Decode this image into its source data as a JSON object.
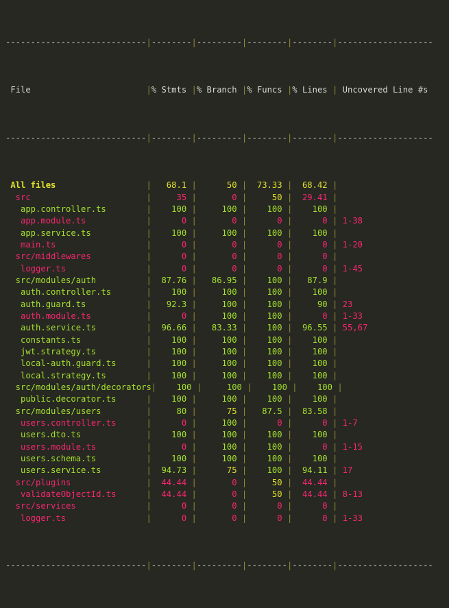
{
  "terminal": {
    "background": "#272822",
    "colors": {
      "text": "#d8d8d2",
      "separator_pipe": "#8f8b36",
      "green": "#a6e22e",
      "yellow": "#e3e32a",
      "pink": "#f92672"
    }
  },
  "report": {
    "type": "coverage-summary-table",
    "columns": [
      {
        "key": "file",
        "label": "File",
        "width": 28,
        "align": "left"
      },
      {
        "key": "stmts",
        "label": "% Stmts",
        "width": 8,
        "align": "right"
      },
      {
        "key": "branch",
        "label": "% Branch",
        "width": 9,
        "align": "right"
      },
      {
        "key": "funcs",
        "label": "% Funcs",
        "width": 8,
        "align": "right"
      },
      {
        "key": "lines",
        "label": "% Lines",
        "width": 8,
        "align": "right"
      },
      {
        "key": "uncovered",
        "label": "Uncovered Line #s",
        "width": 19,
        "align": "left"
      }
    ],
    "separator_char": "-",
    "pipe_char": "|",
    "rows": [
      {
        "indent": 0,
        "file": "All files",
        "bold": true,
        "file_color": "yellow",
        "stmts": "68.1",
        "stmts_color": "yellow",
        "branch": "50",
        "branch_color": "yellow",
        "funcs": "73.33",
        "funcs_color": "yellow",
        "lines": "68.42",
        "lines_color": "yellow",
        "uncovered": "",
        "uncovered_color": "pink"
      },
      {
        "indent": 1,
        "file": "src",
        "bold": false,
        "file_color": "pink",
        "stmts": "35",
        "stmts_color": "pink",
        "branch": "0",
        "branch_color": "pink",
        "funcs": "50",
        "funcs_color": "yellow",
        "lines": "29.41",
        "lines_color": "pink",
        "uncovered": "",
        "uncovered_color": "pink"
      },
      {
        "indent": 2,
        "file": "app.controller.ts",
        "bold": false,
        "file_color": "green",
        "stmts": "100",
        "stmts_color": "green",
        "branch": "100",
        "branch_color": "green",
        "funcs": "100",
        "funcs_color": "green",
        "lines": "100",
        "lines_color": "green",
        "uncovered": "",
        "uncovered_color": "pink"
      },
      {
        "indent": 2,
        "file": "app.module.ts",
        "bold": false,
        "file_color": "pink",
        "stmts": "0",
        "stmts_color": "pink",
        "branch": "0",
        "branch_color": "pink",
        "funcs": "0",
        "funcs_color": "pink",
        "lines": "0",
        "lines_color": "pink",
        "uncovered": "1-38",
        "uncovered_color": "pink"
      },
      {
        "indent": 2,
        "file": "app.service.ts",
        "bold": false,
        "file_color": "green",
        "stmts": "100",
        "stmts_color": "green",
        "branch": "100",
        "branch_color": "green",
        "funcs": "100",
        "funcs_color": "green",
        "lines": "100",
        "lines_color": "green",
        "uncovered": "",
        "uncovered_color": "pink"
      },
      {
        "indent": 2,
        "file": "main.ts",
        "bold": false,
        "file_color": "pink",
        "stmts": "0",
        "stmts_color": "pink",
        "branch": "0",
        "branch_color": "pink",
        "funcs": "0",
        "funcs_color": "pink",
        "lines": "0",
        "lines_color": "pink",
        "uncovered": "1-20",
        "uncovered_color": "pink"
      },
      {
        "indent": 1,
        "file": "src/middlewares",
        "bold": false,
        "file_color": "pink",
        "stmts": "0",
        "stmts_color": "pink",
        "branch": "0",
        "branch_color": "pink",
        "funcs": "0",
        "funcs_color": "pink",
        "lines": "0",
        "lines_color": "pink",
        "uncovered": "",
        "uncovered_color": "pink"
      },
      {
        "indent": 2,
        "file": "logger.ts",
        "bold": false,
        "file_color": "pink",
        "stmts": "0",
        "stmts_color": "pink",
        "branch": "0",
        "branch_color": "pink",
        "funcs": "0",
        "funcs_color": "pink",
        "lines": "0",
        "lines_color": "pink",
        "uncovered": "1-45",
        "uncovered_color": "pink"
      },
      {
        "indent": 1,
        "file": "src/modules/auth",
        "bold": false,
        "file_color": "green",
        "stmts": "87.76",
        "stmts_color": "green",
        "branch": "86.95",
        "branch_color": "green",
        "funcs": "100",
        "funcs_color": "green",
        "lines": "87.9",
        "lines_color": "green",
        "uncovered": "",
        "uncovered_color": "pink"
      },
      {
        "indent": 2,
        "file": "auth.controller.ts",
        "bold": false,
        "file_color": "green",
        "stmts": "100",
        "stmts_color": "green",
        "branch": "100",
        "branch_color": "green",
        "funcs": "100",
        "funcs_color": "green",
        "lines": "100",
        "lines_color": "green",
        "uncovered": "",
        "uncovered_color": "pink"
      },
      {
        "indent": 2,
        "file": "auth.guard.ts",
        "bold": false,
        "file_color": "green",
        "stmts": "92.3",
        "stmts_color": "green",
        "branch": "100",
        "branch_color": "green",
        "funcs": "100",
        "funcs_color": "green",
        "lines": "90",
        "lines_color": "green",
        "uncovered": "23",
        "uncovered_color": "pink"
      },
      {
        "indent": 2,
        "file": "auth.module.ts",
        "bold": false,
        "file_color": "pink",
        "stmts": "0",
        "stmts_color": "pink",
        "branch": "100",
        "branch_color": "green",
        "funcs": "100",
        "funcs_color": "green",
        "lines": "0",
        "lines_color": "pink",
        "uncovered": "1-33",
        "uncovered_color": "pink"
      },
      {
        "indent": 2,
        "file": "auth.service.ts",
        "bold": false,
        "file_color": "green",
        "stmts": "96.66",
        "stmts_color": "green",
        "branch": "83.33",
        "branch_color": "green",
        "funcs": "100",
        "funcs_color": "green",
        "lines": "96.55",
        "lines_color": "green",
        "uncovered": "55,67",
        "uncovered_color": "pink"
      },
      {
        "indent": 2,
        "file": "constants.ts",
        "bold": false,
        "file_color": "green",
        "stmts": "100",
        "stmts_color": "green",
        "branch": "100",
        "branch_color": "green",
        "funcs": "100",
        "funcs_color": "green",
        "lines": "100",
        "lines_color": "green",
        "uncovered": "",
        "uncovered_color": "pink"
      },
      {
        "indent": 2,
        "file": "jwt.strategy.ts",
        "bold": false,
        "file_color": "green",
        "stmts": "100",
        "stmts_color": "green",
        "branch": "100",
        "branch_color": "green",
        "funcs": "100",
        "funcs_color": "green",
        "lines": "100",
        "lines_color": "green",
        "uncovered": "",
        "uncovered_color": "pink"
      },
      {
        "indent": 2,
        "file": "local-auth.guard.ts",
        "bold": false,
        "file_color": "green",
        "stmts": "100",
        "stmts_color": "green",
        "branch": "100",
        "branch_color": "green",
        "funcs": "100",
        "funcs_color": "green",
        "lines": "100",
        "lines_color": "green",
        "uncovered": "",
        "uncovered_color": "pink"
      },
      {
        "indent": 2,
        "file": "local.strategy.ts",
        "bold": false,
        "file_color": "green",
        "stmts": "100",
        "stmts_color": "green",
        "branch": "100",
        "branch_color": "green",
        "funcs": "100",
        "funcs_color": "green",
        "lines": "100",
        "lines_color": "green",
        "uncovered": "",
        "uncovered_color": "pink"
      },
      {
        "indent": 1,
        "file": "src/modules/auth/decorators",
        "bold": false,
        "file_color": "green",
        "stmts": "100",
        "stmts_color": "green",
        "branch": "100",
        "branch_color": "green",
        "funcs": "100",
        "funcs_color": "green",
        "lines": "100",
        "lines_color": "green",
        "uncovered": "",
        "uncovered_color": "pink"
      },
      {
        "indent": 2,
        "file": "public.decorator.ts",
        "bold": false,
        "file_color": "green",
        "stmts": "100",
        "stmts_color": "green",
        "branch": "100",
        "branch_color": "green",
        "funcs": "100",
        "funcs_color": "green",
        "lines": "100",
        "lines_color": "green",
        "uncovered": "",
        "uncovered_color": "pink"
      },
      {
        "indent": 1,
        "file": "src/modules/users",
        "bold": false,
        "file_color": "green",
        "stmts": "80",
        "stmts_color": "green",
        "branch": "75",
        "branch_color": "yellow",
        "funcs": "87.5",
        "funcs_color": "green",
        "lines": "83.58",
        "lines_color": "green",
        "uncovered": "",
        "uncovered_color": "pink"
      },
      {
        "indent": 2,
        "file": "users.controller.ts",
        "bold": false,
        "file_color": "pink",
        "stmts": "0",
        "stmts_color": "pink",
        "branch": "100",
        "branch_color": "green",
        "funcs": "0",
        "funcs_color": "pink",
        "lines": "0",
        "lines_color": "pink",
        "uncovered": "1-7",
        "uncovered_color": "pink"
      },
      {
        "indent": 2,
        "file": "users.dto.ts",
        "bold": false,
        "file_color": "green",
        "stmts": "100",
        "stmts_color": "green",
        "branch": "100",
        "branch_color": "green",
        "funcs": "100",
        "funcs_color": "green",
        "lines": "100",
        "lines_color": "green",
        "uncovered": "",
        "uncovered_color": "pink"
      },
      {
        "indent": 2,
        "file": "users.module.ts",
        "bold": false,
        "file_color": "pink",
        "stmts": "0",
        "stmts_color": "pink",
        "branch": "100",
        "branch_color": "green",
        "funcs": "100",
        "funcs_color": "green",
        "lines": "0",
        "lines_color": "pink",
        "uncovered": "1-15",
        "uncovered_color": "pink"
      },
      {
        "indent": 2,
        "file": "users.schema.ts",
        "bold": false,
        "file_color": "green",
        "stmts": "100",
        "stmts_color": "green",
        "branch": "100",
        "branch_color": "green",
        "funcs": "100",
        "funcs_color": "green",
        "lines": "100",
        "lines_color": "green",
        "uncovered": "",
        "uncovered_color": "pink"
      },
      {
        "indent": 2,
        "file": "users.service.ts",
        "bold": false,
        "file_color": "green",
        "stmts": "94.73",
        "stmts_color": "green",
        "branch": "75",
        "branch_color": "yellow",
        "funcs": "100",
        "funcs_color": "green",
        "lines": "94.11",
        "lines_color": "green",
        "uncovered": "17",
        "uncovered_color": "pink"
      },
      {
        "indent": 1,
        "file": "src/plugins",
        "bold": false,
        "file_color": "pink",
        "stmts": "44.44",
        "stmts_color": "pink",
        "branch": "0",
        "branch_color": "pink",
        "funcs": "50",
        "funcs_color": "yellow",
        "lines": "44.44",
        "lines_color": "pink",
        "uncovered": "",
        "uncovered_color": "pink"
      },
      {
        "indent": 2,
        "file": "validateObjectId.ts",
        "bold": false,
        "file_color": "pink",
        "stmts": "44.44",
        "stmts_color": "pink",
        "branch": "0",
        "branch_color": "pink",
        "funcs": "50",
        "funcs_color": "yellow",
        "lines": "44.44",
        "lines_color": "pink",
        "uncovered": "8-13",
        "uncovered_color": "pink"
      },
      {
        "indent": 1,
        "file": "src/services",
        "bold": false,
        "file_color": "pink",
        "stmts": "0",
        "stmts_color": "pink",
        "branch": "0",
        "branch_color": "pink",
        "funcs": "0",
        "funcs_color": "pink",
        "lines": "0",
        "lines_color": "pink",
        "uncovered": "",
        "uncovered_color": "pink"
      },
      {
        "indent": 2,
        "file": "logger.ts",
        "bold": false,
        "file_color": "pink",
        "stmts": "0",
        "stmts_color": "pink",
        "branch": "0",
        "branch_color": "pink",
        "funcs": "0",
        "funcs_color": "pink",
        "lines": "0",
        "lines_color": "pink",
        "uncovered": "1-33",
        "uncovered_color": "pink"
      }
    ]
  }
}
